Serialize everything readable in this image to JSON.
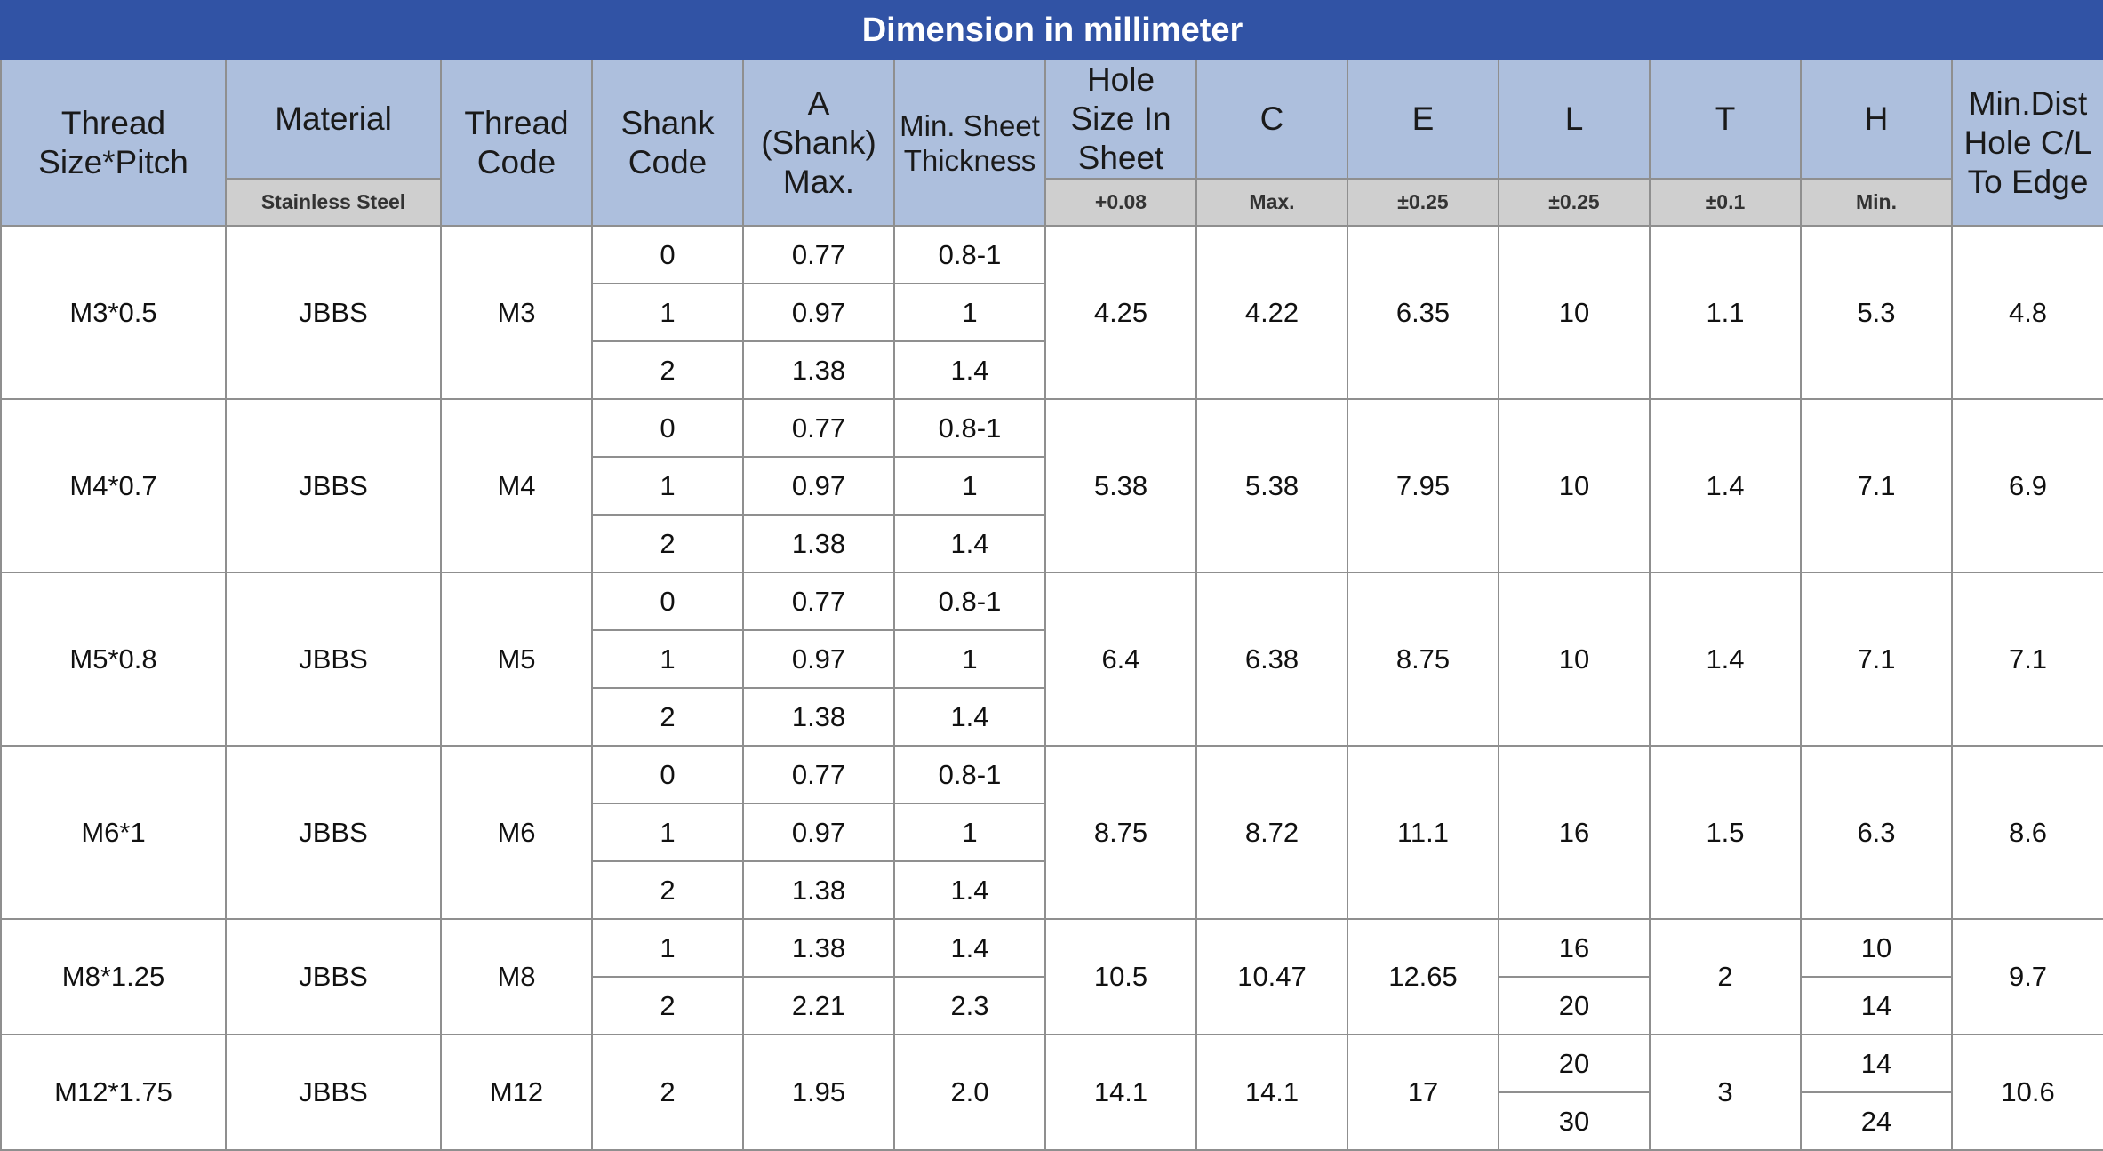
{
  "title": "Dimension in millimeter",
  "headers": {
    "thread_size": "Thread Size*Pitch",
    "material": "Material",
    "material_sub": "Stainless Steel",
    "thread_code": "Thread Code",
    "shank_code": "Shank Code",
    "a_shank": "A (Shank) Max.",
    "min_sheet": "Min. Sheet Thickness",
    "hole_size": "Hole Size In Sheet",
    "hole_size_tol": "+0.08",
    "c": "C",
    "c_tol": "Max.",
    "e": "E",
    "e_tol": "±0.25",
    "l": "L",
    "l_tol": "±0.25",
    "t": "T",
    "t_tol": "±0.1",
    "h": "H",
    "h_tol": "Min.",
    "min_dist": "Min.Dist Hole C/L To Edge"
  },
  "groups": [
    {
      "thread": "M3*0.5",
      "material": "JBBS",
      "code": "M3",
      "hole": "4.25",
      "c": "4.22",
      "e": "6.35",
      "t": "1.1",
      "min_dist": "4.8",
      "l": [
        "10"
      ],
      "h": [
        "5.3"
      ],
      "shanks": [
        {
          "shank": "0",
          "a": "0.77",
          "sheet": "0.8-1"
        },
        {
          "shank": "1",
          "a": "0.97",
          "sheet": "1"
        },
        {
          "shank": "2",
          "a": "1.38",
          "sheet": "1.4"
        }
      ]
    },
    {
      "thread": "M4*0.7",
      "material": "JBBS",
      "code": "M4",
      "hole": "5.38",
      "c": "5.38",
      "e": "7.95",
      "t": "1.4",
      "min_dist": "6.9",
      "l": [
        "10"
      ],
      "h": [
        "7.1"
      ],
      "shanks": [
        {
          "shank": "0",
          "a": "0.77",
          "sheet": "0.8-1"
        },
        {
          "shank": "1",
          "a": "0.97",
          "sheet": "1"
        },
        {
          "shank": "2",
          "a": "1.38",
          "sheet": "1.4"
        }
      ]
    },
    {
      "thread": "M5*0.8",
      "material": "JBBS",
      "code": "M5",
      "hole": "6.4",
      "c": "6.38",
      "e": "8.75",
      "t": "1.4",
      "min_dist": "7.1",
      "l": [
        "10"
      ],
      "h": [
        "7.1"
      ],
      "shanks": [
        {
          "shank": "0",
          "a": "0.77",
          "sheet": "0.8-1"
        },
        {
          "shank": "1",
          "a": "0.97",
          "sheet": "1"
        },
        {
          "shank": "2",
          "a": "1.38",
          "sheet": "1.4"
        }
      ]
    },
    {
      "thread": "M6*1",
      "material": "JBBS",
      "code": "M6",
      "hole": "8.75",
      "c": "8.72",
      "e": "11.1",
      "t": "1.5",
      "min_dist": "8.6",
      "l": [
        "16"
      ],
      "h": [
        "6.3"
      ],
      "shanks": [
        {
          "shank": "0",
          "a": "0.77",
          "sheet": "0.8-1"
        },
        {
          "shank": "1",
          "a": "0.97",
          "sheet": "1"
        },
        {
          "shank": "2",
          "a": "1.38",
          "sheet": "1.4"
        }
      ]
    },
    {
      "thread": "M8*1.25",
      "material": "JBBS",
      "code": "M8",
      "hole": "10.5",
      "c": "10.47",
      "e": "12.65",
      "t": "2",
      "min_dist": "9.7",
      "l": [
        "16",
        "20"
      ],
      "h": [
        "10",
        "14"
      ],
      "shanks": [
        {
          "shank": "1",
          "a": "1.38",
          "sheet": "1.4"
        },
        {
          "shank": "2",
          "a": "2.21",
          "sheet": "2.3"
        }
      ]
    },
    {
      "thread": "M12*1.75",
      "material": "JBBS",
      "code": "M12",
      "hole": "14.1",
      "c": "14.1",
      "e": "17",
      "t": "3",
      "min_dist": "10.6",
      "l": [
        "20",
        "30"
      ],
      "h": [
        "14",
        "24"
      ],
      "shanks": [
        {
          "shank": "2",
          "a": "1.95",
          "sheet": "2.0"
        }
      ],
      "subrows": 2
    }
  ]
}
